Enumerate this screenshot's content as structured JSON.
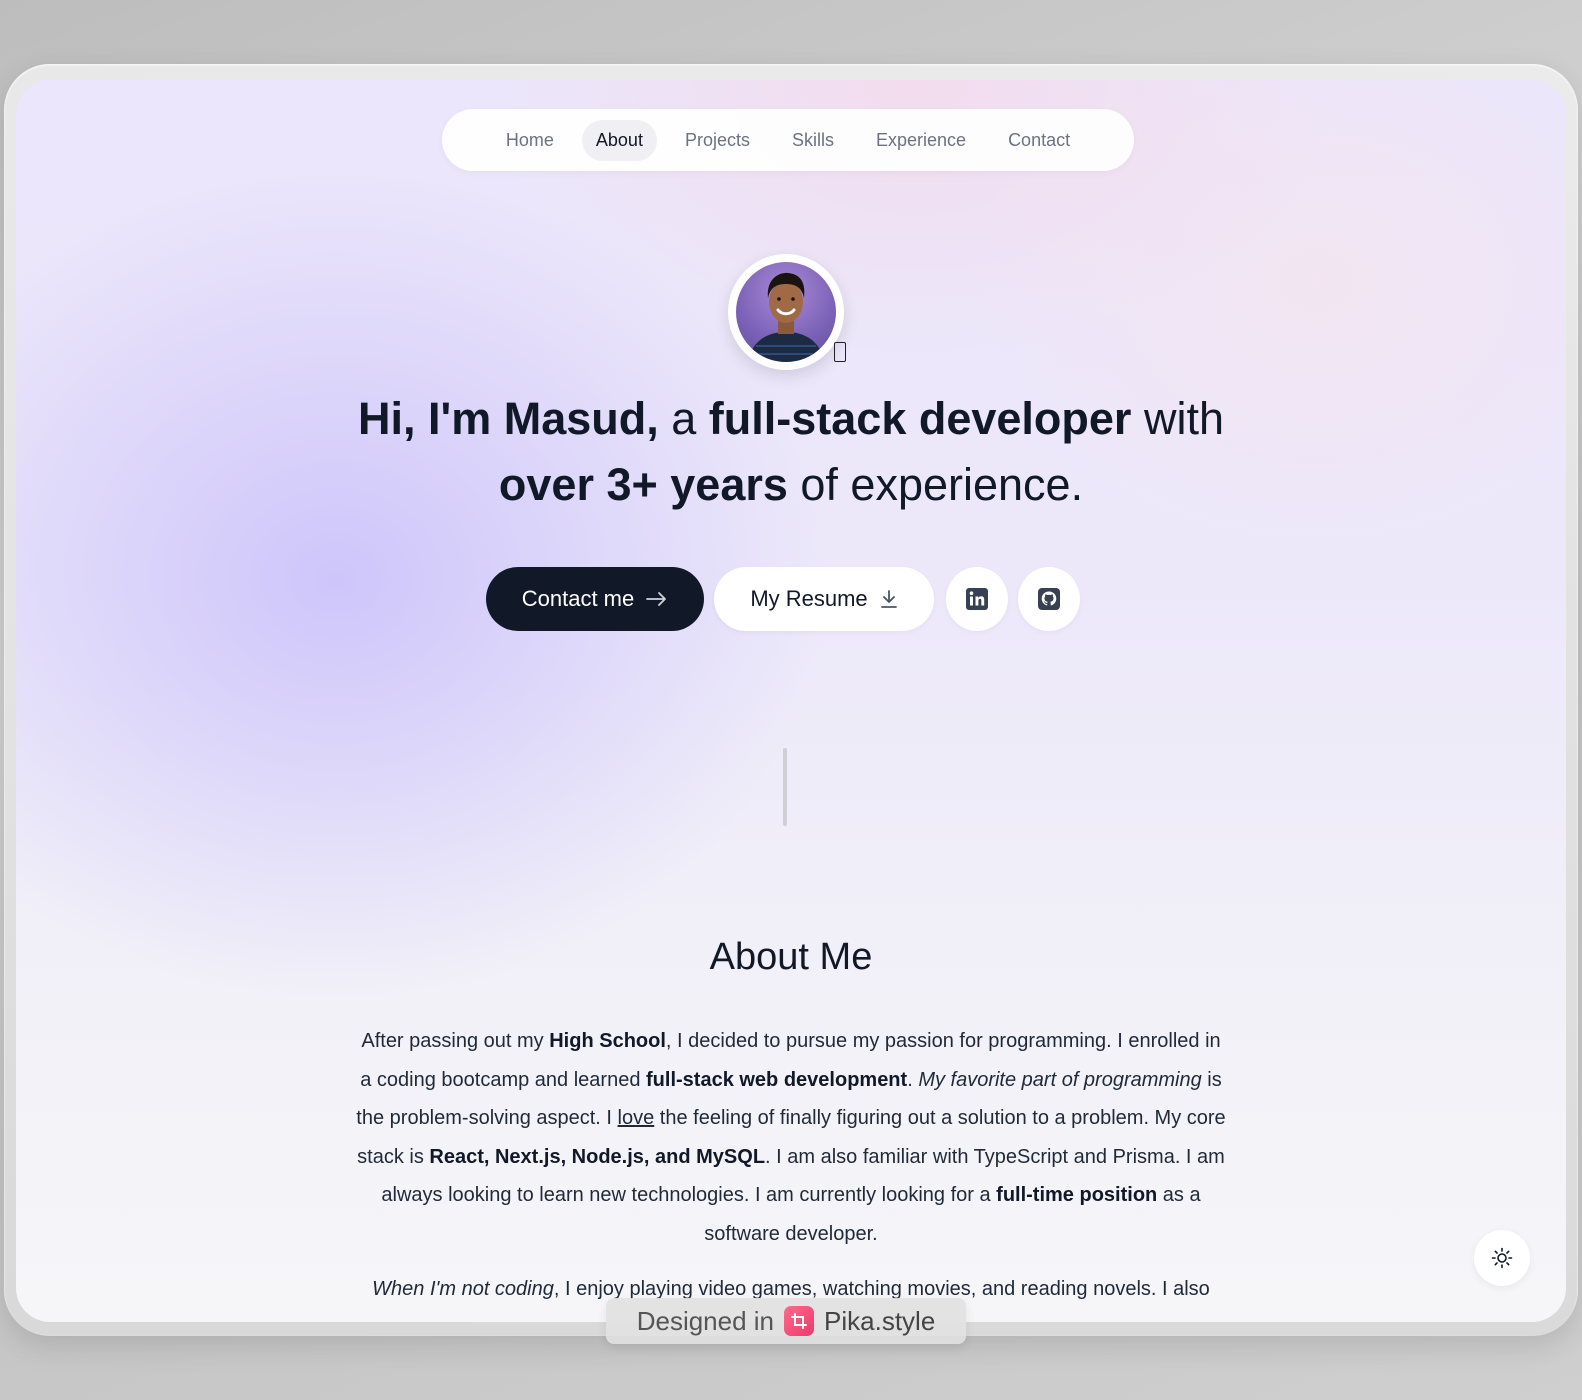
{
  "nav": {
    "items": [
      {
        "label": "Home",
        "active": false
      },
      {
        "label": "About",
        "active": true
      },
      {
        "label": "Projects",
        "active": false
      },
      {
        "label": "Skills",
        "active": false
      },
      {
        "label": "Experience",
        "active": false
      },
      {
        "label": "Contact",
        "active": false
      }
    ]
  },
  "hero": {
    "headline": {
      "p1": "Hi, I'm Masud,",
      "p2": " a ",
      "p3": "full-stack developer",
      "p4": " with",
      "p5": "over 3+ years",
      "p6": " of experience."
    },
    "contact_button": "Contact me",
    "resume_button": "My Resume",
    "linkedin_icon": "linkedin-icon",
    "github_icon": "github-icon"
  },
  "about": {
    "title": "About Me",
    "para1": {
      "s1": "After passing out my ",
      "s2": "High School",
      "s3": ", I decided to pursue my passion for programming. I enrolled in a coding bootcamp and learned ",
      "s4": "full-stack web development",
      "s5": ". ",
      "s6": "My favorite part of programming",
      "s7": " is the problem-solving aspect. I ",
      "s8": "love",
      "s9": " the feeling of finally figuring out a solution to a problem. My core stack is ",
      "s10": "React, Next.js, Node.js, and MySQL",
      "s11": ". I am also familiar with TypeScript and Prisma. I am always looking to learn new technologies. I am currently looking for a ",
      "s12": "full-time position",
      "s13": " as a software developer."
    },
    "para2": {
      "s1": "When I'm not coding",
      "s2": ", I enjoy playing video games, watching movies, and reading novels. I also"
    }
  },
  "theme_toggle_icon": "sun-icon",
  "watermark": {
    "prefix": "Designed in",
    "brand": "Pika.style"
  },
  "colors": {
    "primary_dark": "#111827",
    "nav_active_bg": "#f0eff3",
    "pika_pink": "#e83a6c"
  }
}
